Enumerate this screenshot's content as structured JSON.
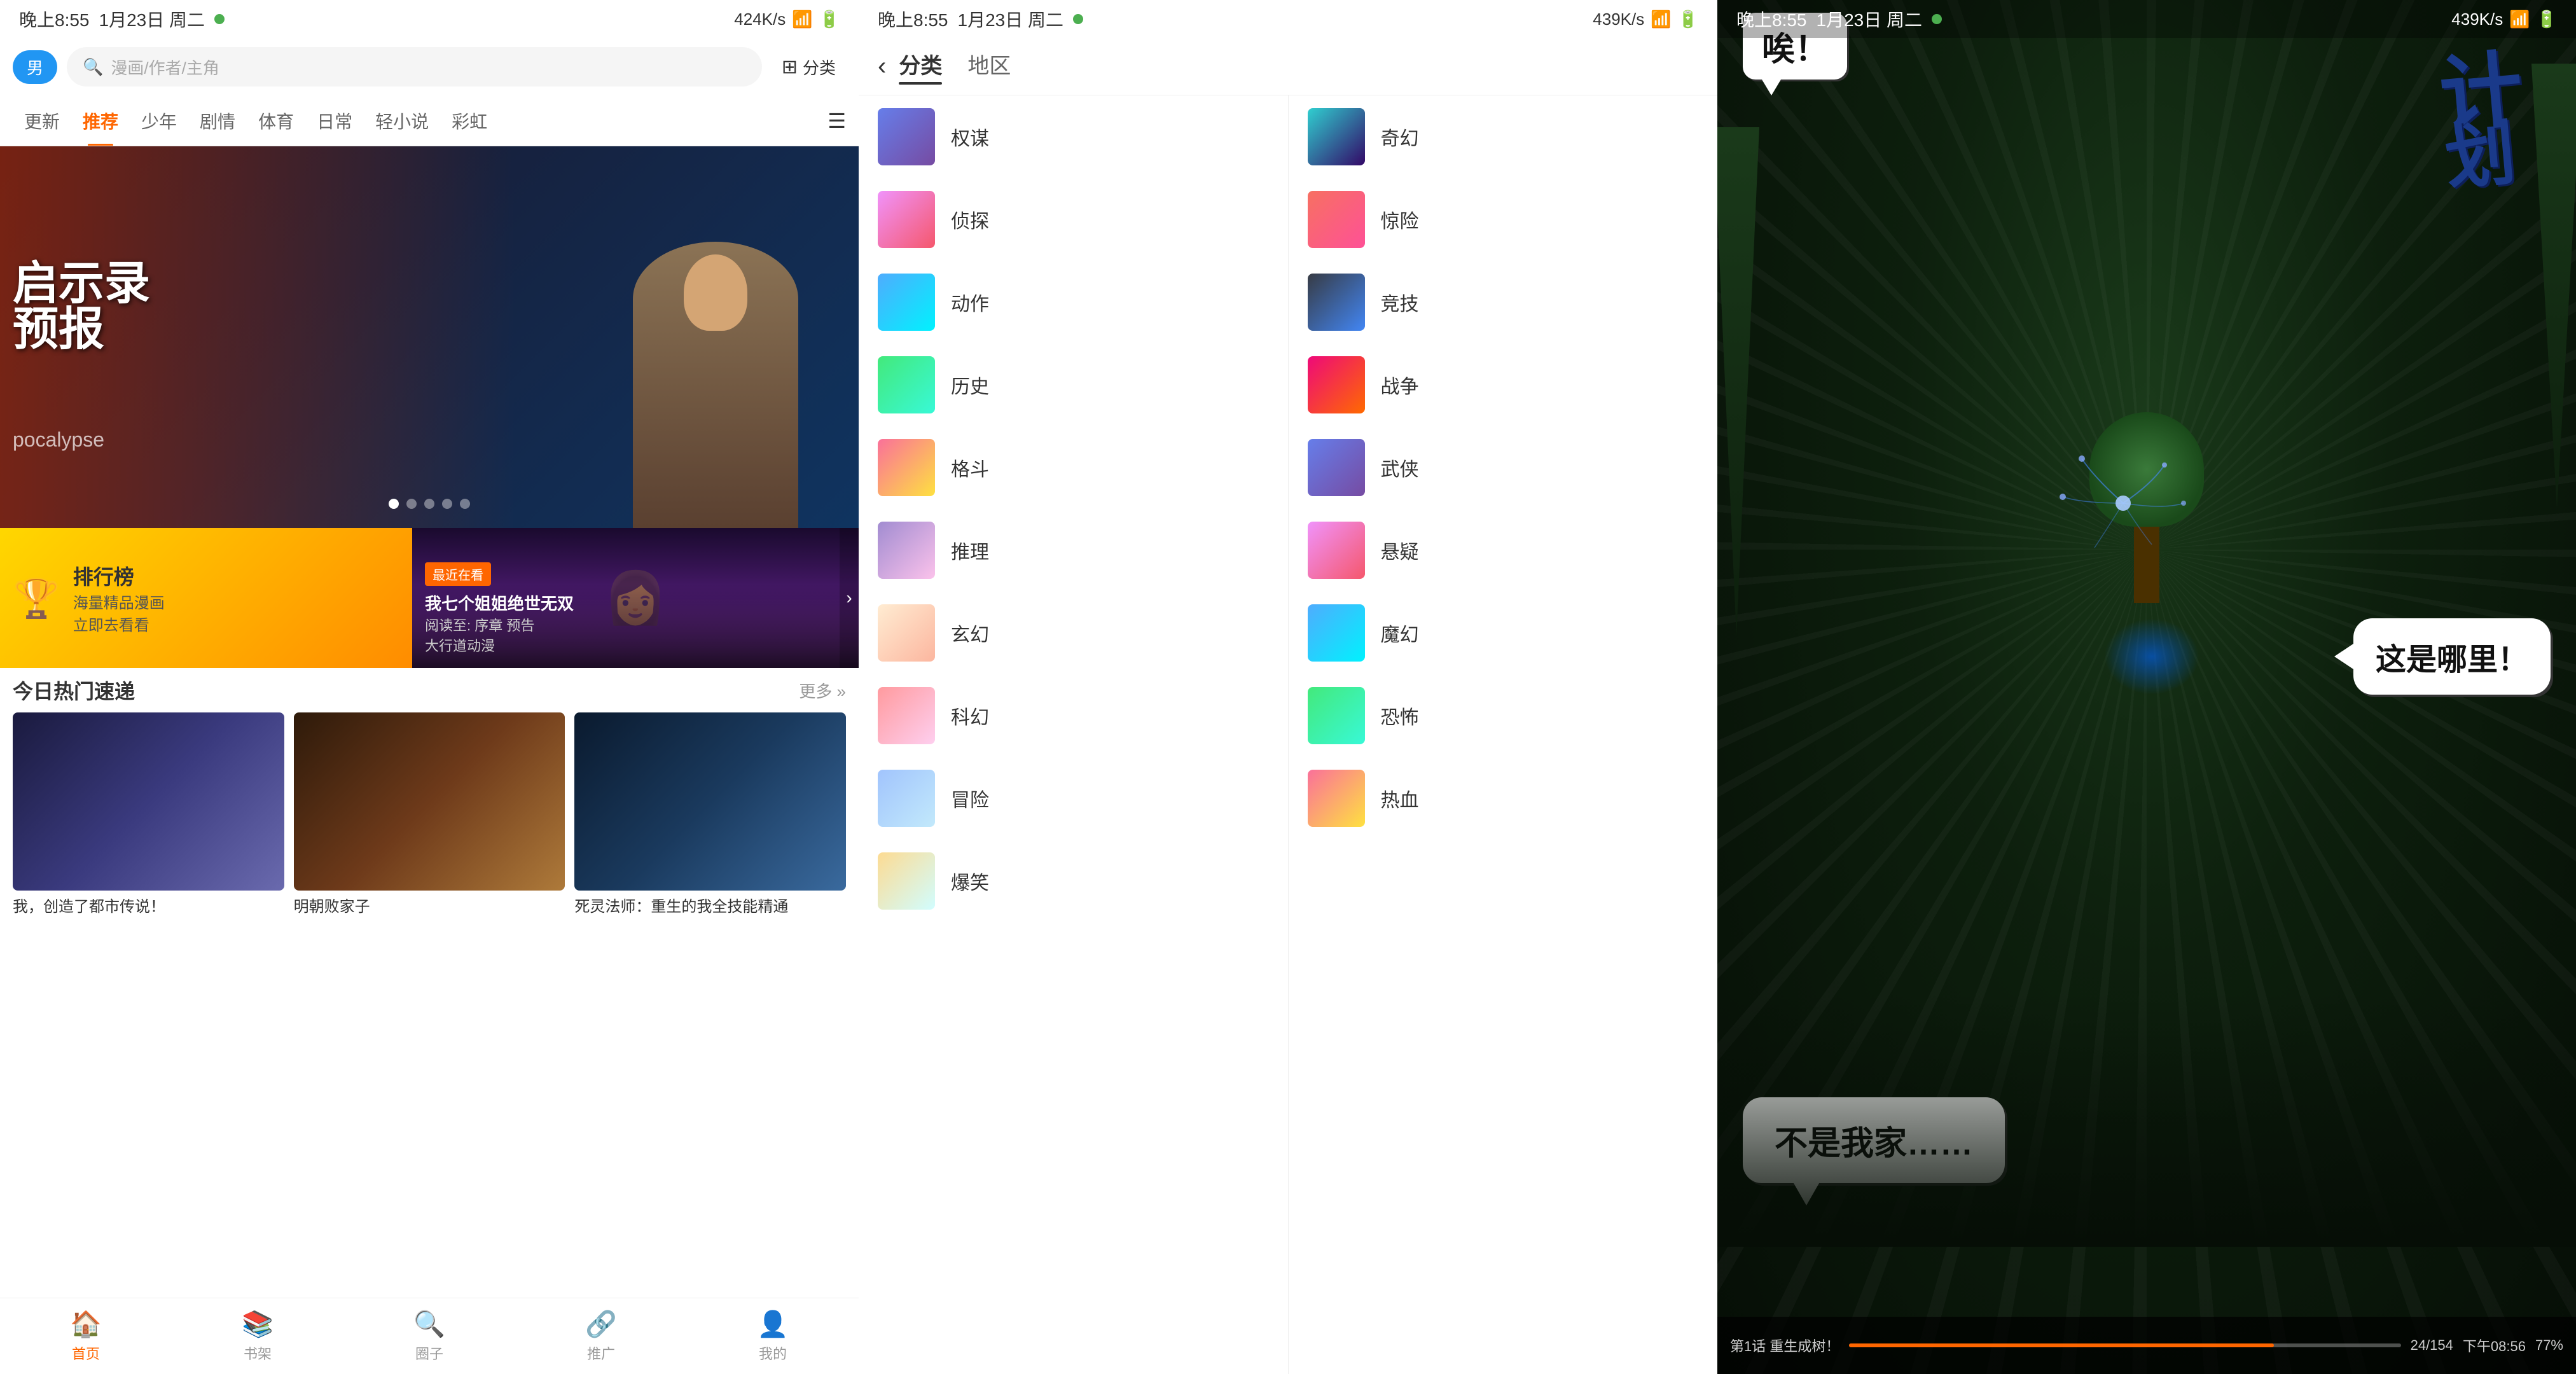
{
  "panel1": {
    "statusBar": {
      "time": "晚上8:55",
      "date": "1月23日 周二",
      "signal": "424K/s",
      "wifi": "WiFi",
      "batteryIcon": "🔋"
    },
    "header": {
      "genderLabel": "男",
      "searchPlaceholder": "漫画/作者/主角",
      "categoryLabel": "分类"
    },
    "navTabs": [
      "更新",
      "推荐",
      "少年",
      "剧情",
      "体育",
      "日常",
      "轻小说",
      "彩虹"
    ],
    "activeTab": "推荐",
    "banner": {
      "titleCn": "启示录预报",
      "titleEn": "pocalypse",
      "dots": 5,
      "activeDot": 2
    },
    "rankCard": {
      "icon": "🏆",
      "title": "排行榜",
      "subtitle": "海量精品漫画",
      "action": "立即去看看"
    },
    "recentCard": {
      "tag": "最近在看",
      "title": "我七个姐姐绝世无双",
      "subtitle1": "阅读至: 序章 预告",
      "subtitle2": "大行道动漫"
    },
    "hotSection": {
      "title": "今日热门速递",
      "moreLabel": "更多 »",
      "items": [
        {
          "title": "我，创造了都市传说！"
        },
        {
          "title": "明朝败家子"
        },
        {
          "title": "死灵法师：重生的我全技能精通"
        }
      ]
    },
    "bottomNav": [
      {
        "icon": "🏠",
        "label": "首页",
        "active": true
      },
      {
        "icon": "📚",
        "label": "书架",
        "active": false
      },
      {
        "icon": "🔍",
        "label": "圈子",
        "active": false
      },
      {
        "icon": "🔗",
        "label": "推广",
        "active": false
      },
      {
        "icon": "👤",
        "label": "我的",
        "active": false
      }
    ]
  },
  "panel2": {
    "statusBar": {
      "time": "晚上8:55",
      "date": "1月23日 周二",
      "signal": "439K/s"
    },
    "header": {
      "backLabel": "‹",
      "tabs": [
        "分类",
        "地区"
      ],
      "activeTab": "分类"
    },
    "categories": [
      {
        "name": "权谋",
        "colorClass": "ct1"
      },
      {
        "name": "侦探",
        "colorClass": "ct2"
      },
      {
        "name": "动作",
        "colorClass": "ct3"
      },
      {
        "name": "历史",
        "colorClass": "ct4"
      },
      {
        "name": "格斗",
        "colorClass": "ct5"
      },
      {
        "name": "推理",
        "colorClass": "ct6"
      },
      {
        "name": "玄幻",
        "colorClass": "ct7"
      },
      {
        "name": "科幻",
        "colorClass": "ct8"
      },
      {
        "name": "冒险",
        "colorClass": "ct9"
      },
      {
        "name": "爆笑",
        "colorClass": "ct10"
      }
    ],
    "categoriesRight": [
      {
        "name": "奇幻",
        "colorClass": "ct11"
      },
      {
        "name": "惊险",
        "colorClass": "ct12"
      },
      {
        "name": "竞技",
        "colorClass": "ct13"
      },
      {
        "name": "战争",
        "colorClass": "ct14"
      },
      {
        "name": "武侠",
        "colorClass": "ct1"
      },
      {
        "name": "悬疑",
        "colorClass": "ct2"
      },
      {
        "name": "魔幻",
        "colorClass": "ct3"
      },
      {
        "name": "恐怖",
        "colorClass": "ct4"
      },
      {
        "name": "热血",
        "colorClass": "ct5"
      }
    ]
  },
  "panel3": {
    "statusBar": {
      "time": "晚上8:55",
      "date": "1月23日 周二",
      "signal": "439K/s"
    },
    "reader": {
      "exclamation": "唉！",
      "brushText": "计划",
      "speech1": "这是哪里！",
      "speech2": "不是我家……",
      "chapterInfo": "第1话 重生成树！",
      "progress": "24/154",
      "time": "下午08:56",
      "battery": "77%"
    }
  }
}
